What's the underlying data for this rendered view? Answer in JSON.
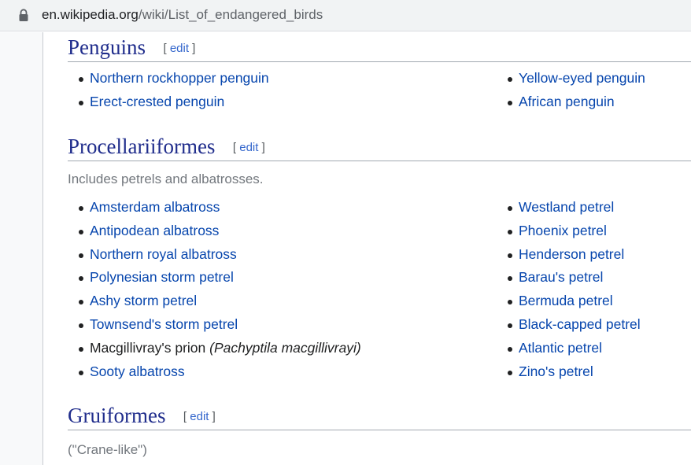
{
  "address_bar": {
    "host": "en.wikipedia.org",
    "path": "/wiki/List_of_endangered_birds"
  },
  "edit_label": "edit",
  "sections": [
    {
      "title": "Penguins",
      "left": [
        "Northern rockhopper penguin",
        "Erect-crested penguin"
      ],
      "right": [
        "Yellow-eyed penguin",
        "African penguin"
      ]
    },
    {
      "title": "Procellariiformes",
      "description": "Includes petrels and albatrosses.",
      "left": [
        "Amsterdam albatross",
        "Antipodean albatross",
        "Northern royal albatross",
        "Polynesian storm petrel",
        "Ashy storm petrel",
        "Townsend's storm petrel",
        "Macgillivray's prion",
        "Sooty albatross"
      ],
      "macgillivray_scientific": "(Pachyptila macgillivrayi)",
      "right": [
        "Westland petrel",
        "Phoenix petrel",
        "Henderson petrel",
        "Barau's petrel",
        "Bermuda petrel",
        "Black-capped petrel",
        "Atlantic petrel",
        "Zino's petrel"
      ]
    },
    {
      "title": "Gruiformes",
      "description": "(\"Crane-like\")"
    }
  ]
}
